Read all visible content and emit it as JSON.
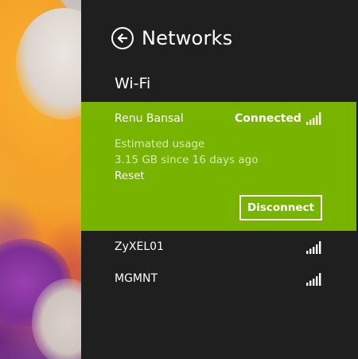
{
  "panel": {
    "title": "Networks",
    "section": "Wi-Fi"
  },
  "connected_network": {
    "name": "Renu Bansal",
    "status": "Connected",
    "usage_label": "Estimated usage",
    "usage_value": "3.15 GB since 16 days ago",
    "reset_label": "Reset",
    "disconnect_label": "Disconnect"
  },
  "networks": [
    {
      "name": "ZyXEL01"
    },
    {
      "name": "MGMNT"
    }
  ],
  "colors": {
    "panel_background": "#1f1f1f",
    "connected_tile": "#78b300",
    "text": "#ffffff"
  },
  "icons": {
    "back": "back-arrow-icon",
    "signal": "wifi-signal-icon"
  }
}
